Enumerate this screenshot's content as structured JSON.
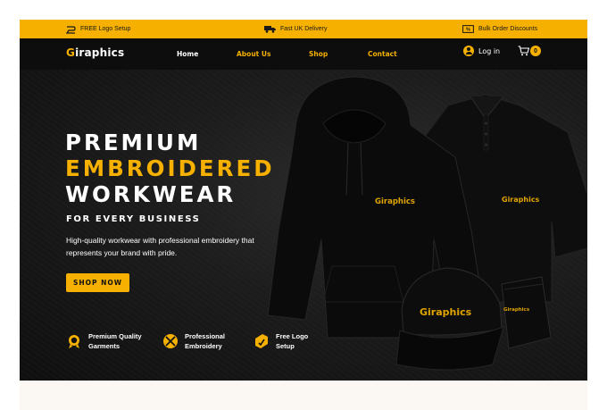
{
  "topbar": {
    "items": [
      {
        "icon": "logo-setup-icon",
        "label": "FREE Logo Setup"
      },
      {
        "icon": "delivery-truck-icon",
        "label": "Fast UK Delivery"
      },
      {
        "icon": "discount-tag-icon",
        "label": "Bulk Order Discounts"
      }
    ]
  },
  "nav": {
    "brand_initial": "G",
    "brand_rest": "iraphics",
    "links": [
      "Home",
      "About Us",
      "Shop",
      "Contact"
    ],
    "login_label": "Log in",
    "cart_count": "0"
  },
  "hero": {
    "headline_1": "PREMIUM",
    "headline_2": "EMBROIDERED",
    "headline_3": "WORKWEAR",
    "subheadline": "FOR EVERY BUSINESS",
    "description": "High-quality workwear with professional embroidery that represents your brand with pride.",
    "cta_label": "SHOP NOW",
    "features": [
      {
        "icon": "quality-medal-icon",
        "line1": "Premium Quality",
        "line2": "Garments"
      },
      {
        "icon": "embroidery-needle-icon",
        "line1": "Professional",
        "line2": "Embroidery"
      },
      {
        "icon": "logo-setup-icon",
        "line1": "Free Logo",
        "line2": "Setup"
      }
    ],
    "product_logo": "Giraphics"
  },
  "colors": {
    "accent": "#f5b000",
    "dark": "#121212",
    "text_light": "#ffffff"
  }
}
